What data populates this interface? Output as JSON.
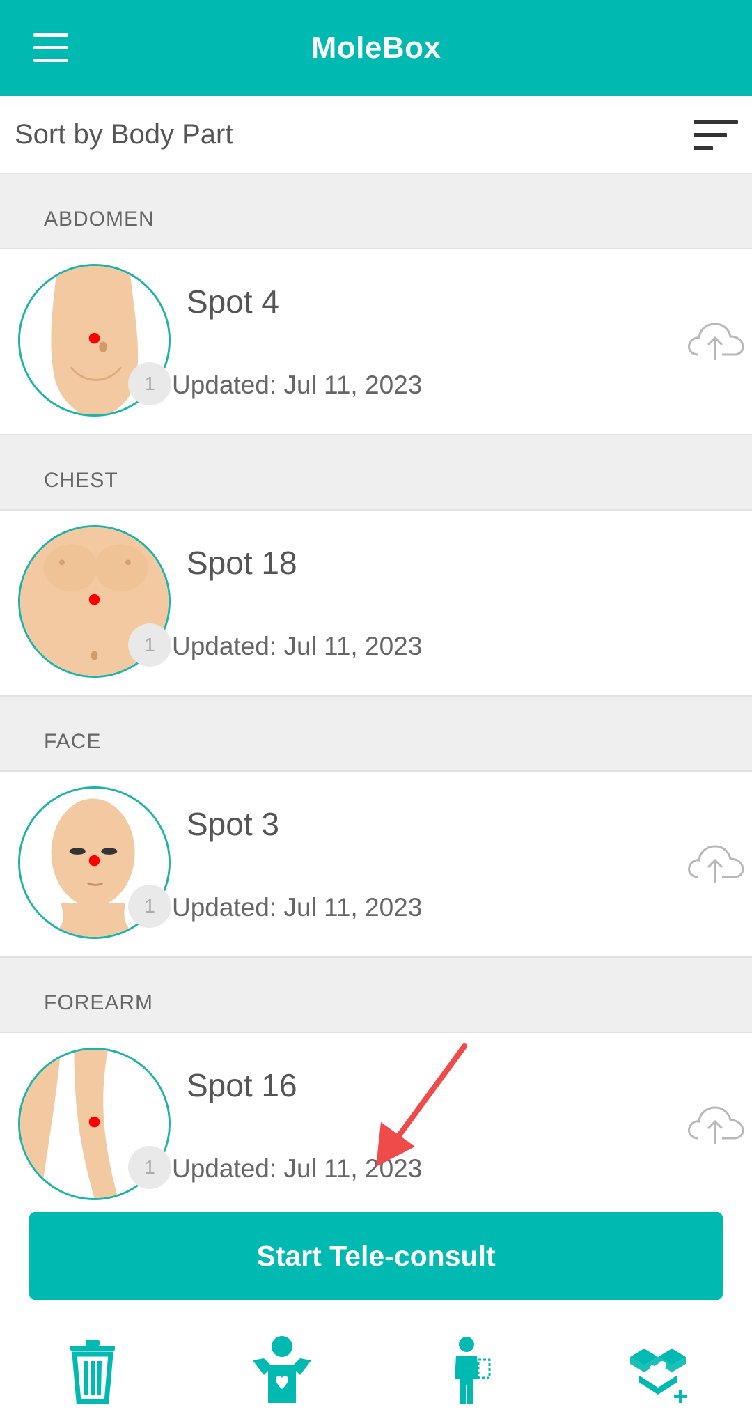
{
  "app": {
    "title": "MoleBox"
  },
  "icons": {
    "menu": "menu-icon",
    "sort": "sort-icon",
    "cloud_upload": "cloud-upload-icon",
    "trash": "trash-icon",
    "body_map": "person-heart-icon",
    "doctor": "doctor-icon",
    "dropbox_add": "dropbox-add-icon"
  },
  "colors": {
    "brand": "#00b9b0",
    "marker": "#ff0000",
    "arrow": "#ef4b4b"
  },
  "sort": {
    "label": "Sort by Body Part"
  },
  "sections": [
    {
      "header": "ABDOMEN",
      "spot": {
        "name": "Spot 4",
        "count": "1",
        "updated": "Updated: Jul 11, 2023",
        "cloud": true
      }
    },
    {
      "header": "CHEST",
      "spot": {
        "name": "Spot 18",
        "count": "1",
        "updated": "Updated: Jul 11, 2023",
        "cloud": false
      }
    },
    {
      "header": "FACE",
      "spot": {
        "name": "Spot 3",
        "count": "1",
        "updated": "Updated: Jul 11, 2023",
        "cloud": true
      }
    },
    {
      "header": "FOREARM",
      "spot": {
        "name": "Spot 16",
        "count": "1",
        "updated": "Updated: Jul 11, 2023",
        "cloud": true
      }
    }
  ],
  "cta": {
    "label": "Start Tele-consult"
  }
}
